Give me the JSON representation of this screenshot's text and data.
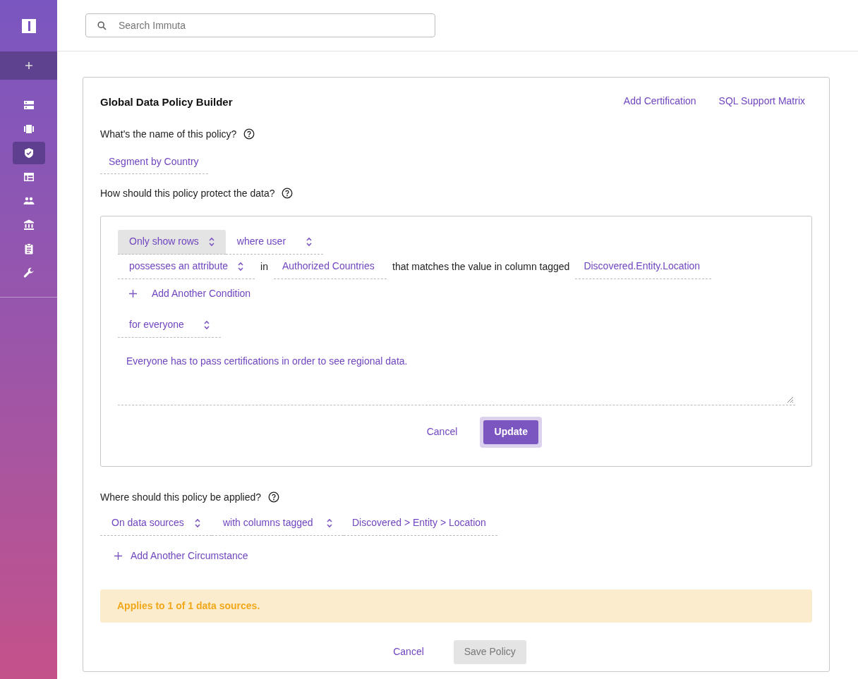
{
  "sidebar": {
    "items": [
      {
        "selected": false
      },
      {
        "selected": false
      },
      {
        "selected": true
      },
      {
        "selected": false
      },
      {
        "selected": false
      },
      {
        "selected": false
      },
      {
        "selected": false
      },
      {
        "selected": false
      }
    ]
  },
  "search": {
    "placeholder": "Search Immuta"
  },
  "builder": {
    "title": "Global Data Policy Builder",
    "links": [
      "Add Certification",
      "SQL Support Matrix"
    ],
    "name_question": "What's the name of this policy?",
    "name_value": "Segment by Country",
    "protect_question": "How should this policy protect the data?",
    "rule": {
      "row1": [
        {
          "kind": "select",
          "text": "Only show rows",
          "active": true
        },
        {
          "kind": "select",
          "text": "where user",
          "active": false
        }
      ],
      "row2": [
        {
          "kind": "select",
          "text": "possesses an attribute",
          "active": false
        },
        {
          "kind": "text",
          "text": "in"
        },
        {
          "kind": "field",
          "text": "Authorized Countries"
        },
        {
          "kind": "text",
          "text": "that matches the value in column tagged"
        },
        {
          "kind": "field",
          "text": "Discovered.Entity.Location"
        }
      ],
      "add_condition": "Add Another Condition",
      "audience": {
        "kind": "select",
        "text": "for everyone",
        "active": false
      },
      "description": "Everyone has to pass certifications in order to see regional data.",
      "cancel": "Cancel",
      "update": "Update"
    },
    "where_question": "Where should this policy be applied?",
    "circumstance": [
      {
        "kind": "select",
        "text": "On data sources",
        "active": false
      },
      {
        "kind": "select",
        "text": "with columns tagged",
        "active": false
      },
      {
        "kind": "field",
        "text": "Discovered > Entity > Location"
      }
    ],
    "add_circumstance": "Add Another Circumstance",
    "notice": "Applies to 1 of 1 data sources.",
    "cancel": "Cancel",
    "save": "Save Policy"
  }
}
